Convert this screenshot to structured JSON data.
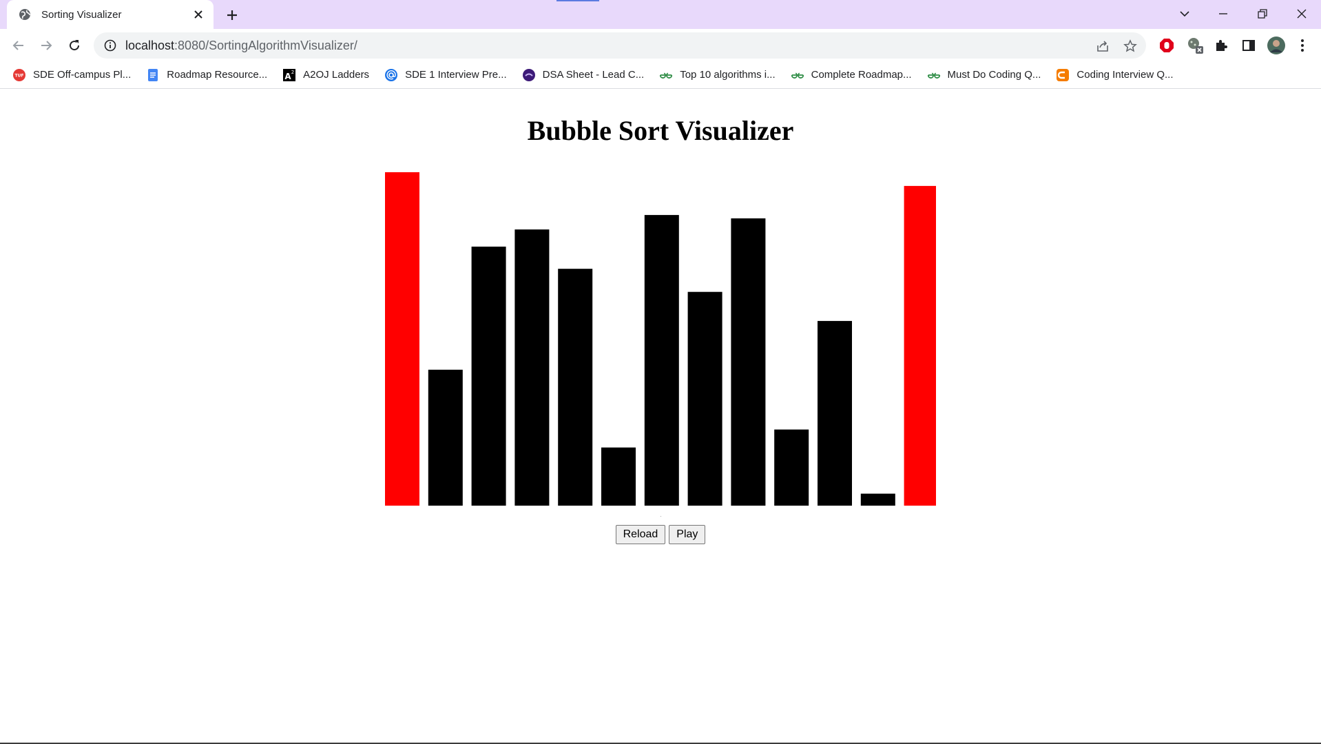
{
  "browser": {
    "tab": {
      "title": "Sorting Visualizer",
      "favicon": "globe-icon"
    },
    "address": {
      "host": "localhost",
      "rest": ":8080/SortingAlgorithmVisualizer/"
    },
    "bookmarks": [
      {
        "label": "SDE Off-campus Pl...",
        "icon": "tuf-icon",
        "color": "#e53935"
      },
      {
        "label": "Roadmap Resource...",
        "icon": "docs-icon",
        "color": "#4285f4"
      },
      {
        "label": "A2OJ Ladders",
        "icon": "a2oj-icon",
        "color": "#000000"
      },
      {
        "label": "SDE 1 Interview Pre...",
        "icon": "at-icon",
        "color": "#1a73e8"
      },
      {
        "label": "DSA Sheet - Lead C...",
        "icon": "lc-icon",
        "color": "#3d1a78"
      },
      {
        "label": "Top 10 algorithms i...",
        "icon": "gfg-icon",
        "color": "#2f8d46"
      },
      {
        "label": "Complete Roadmap...",
        "icon": "gfg-icon",
        "color": "#2f8d46"
      },
      {
        "label": "Must Do Coding Q...",
        "icon": "gfg-icon",
        "color": "#2f8d46"
      },
      {
        "label": "Coding Interview Q...",
        "icon": "cf-icon",
        "color": "#f57c00"
      }
    ]
  },
  "page": {
    "title": "Bubble Sort Visualizer",
    "reload_label": "Reload",
    "play_label": "Play"
  },
  "chart_data": {
    "type": "bar",
    "values": [
      390,
      159,
      303,
      323,
      277,
      68,
      340,
      250,
      336,
      89,
      216,
      14,
      374
    ],
    "highlighted": [
      0,
      12
    ],
    "bar_color": "#000000",
    "highlight_color": "#ff0000"
  }
}
